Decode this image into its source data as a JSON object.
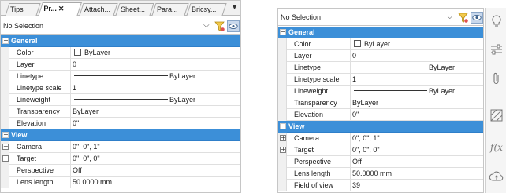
{
  "left_panel": {
    "tabs": [
      "Tips",
      "Pr...",
      "Attach...",
      "Sheet...",
      "Para...",
      "Bricsy..."
    ],
    "tab_close": "✕",
    "tab_menu": "▼",
    "selection": "No Selection",
    "sections": [
      {
        "title": "General",
        "rows": [
          {
            "name": "Color",
            "value": "ByLayer",
            "kind": "color"
          },
          {
            "name": "Layer",
            "value": "0"
          },
          {
            "name": "Linetype",
            "value": "ByLayer",
            "kind": "line"
          },
          {
            "name": "Linetype scale",
            "value": "1"
          },
          {
            "name": "Lineweight",
            "value": "ByLayer",
            "kind": "line"
          },
          {
            "name": "Transparency",
            "value": "ByLayer"
          },
          {
            "name": "Elevation",
            "value": "0\""
          }
        ]
      },
      {
        "title": "View",
        "rows": [
          {
            "name": "Camera",
            "value": "0\", 0\", 1\"",
            "expandable": true
          },
          {
            "name": "Target",
            "value": "0\", 0\", 0\"",
            "expandable": true
          },
          {
            "name": "Perspective",
            "value": "Off"
          },
          {
            "name": "Lens length",
            "value": "50.0000 mm"
          }
        ]
      }
    ]
  },
  "right_panel": {
    "selection": "No Selection",
    "sections": [
      {
        "title": "General",
        "rows": [
          {
            "name": "Color",
            "value": "ByLayer",
            "kind": "color"
          },
          {
            "name": "Layer",
            "value": "0"
          },
          {
            "name": "Linetype",
            "value": "ByLayer",
            "kind": "line"
          },
          {
            "name": "Linetype scale",
            "value": "1"
          },
          {
            "name": "Lineweight",
            "value": "ByLayer",
            "kind": "line"
          },
          {
            "name": "Transparency",
            "value": "ByLayer"
          },
          {
            "name": "Elevation",
            "value": "0\""
          }
        ]
      },
      {
        "title": "View",
        "rows": [
          {
            "name": "Camera",
            "value": "0\", 0\", 1\"",
            "expandable": true
          },
          {
            "name": "Target",
            "value": "0\", 0\", 0\"",
            "expandable": true
          },
          {
            "name": "Perspective",
            "value": "Off"
          },
          {
            "name": "Lens length",
            "value": "50.0000 mm"
          },
          {
            "name": "Field of view",
            "value": "39"
          }
        ]
      }
    ]
  },
  "sidebar_icons": [
    "lightbulb-icon",
    "sliders-icon",
    "paperclip-icon",
    "hatch-icon",
    "function-icon",
    "cloud-upload-icon"
  ],
  "colors": {
    "section_header": "#3c8fd8",
    "selection_button": "#c8d8ec"
  }
}
